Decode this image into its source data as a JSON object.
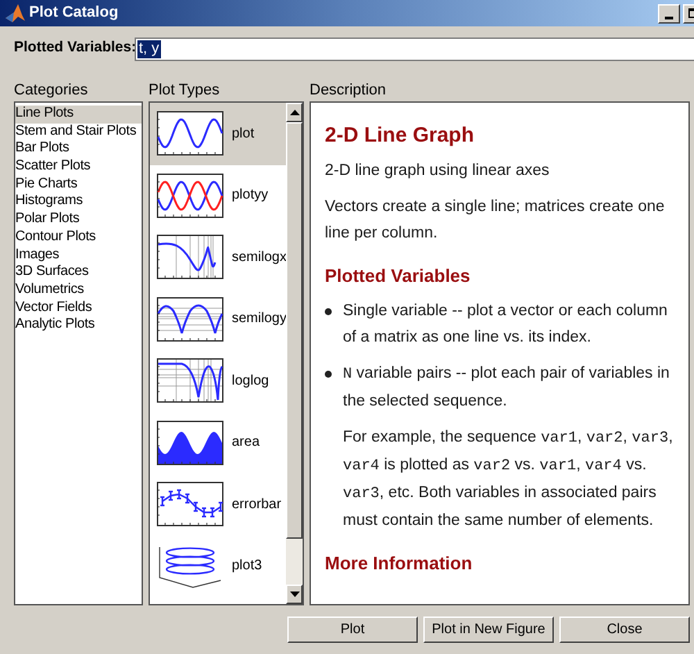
{
  "window": {
    "title": "Plot Catalog"
  },
  "plotted_variables": {
    "label": "Plotted Variables:",
    "value": "t, y"
  },
  "categories": {
    "heading": "Categories",
    "items": [
      {
        "label": "Line Plots",
        "selected": true
      },
      {
        "label": "Stem and Stair Plots",
        "selected": false
      },
      {
        "label": "Bar Plots",
        "selected": false
      },
      {
        "label": "Scatter Plots",
        "selected": false
      },
      {
        "label": "Pie Charts",
        "selected": false
      },
      {
        "label": "Histograms",
        "selected": false
      },
      {
        "label": "Polar Plots",
        "selected": false
      },
      {
        "label": "Contour Plots",
        "selected": false
      },
      {
        "label": "Images",
        "selected": false
      },
      {
        "label": "3D Surfaces",
        "selected": false
      },
      {
        "label": "Volumetrics",
        "selected": false
      },
      {
        "label": "Vector Fields",
        "selected": false
      },
      {
        "label": "Analytic Plots",
        "selected": false
      }
    ]
  },
  "plot_types": {
    "heading": "Plot Types",
    "items": [
      {
        "label": "plot",
        "selected": true
      },
      {
        "label": "plotyy",
        "selected": false
      },
      {
        "label": "semilogx",
        "selected": false
      },
      {
        "label": "semilogy",
        "selected": false
      },
      {
        "label": "loglog",
        "selected": false
      },
      {
        "label": "area",
        "selected": false
      },
      {
        "label": "errorbar",
        "selected": false
      },
      {
        "label": "plot3",
        "selected": false
      }
    ]
  },
  "description": {
    "heading": "Description",
    "blocks": [
      {
        "kind": "title",
        "parts": [
          {
            "kind": "text",
            "text": "2-D Line Graph"
          }
        ]
      },
      {
        "kind": "paragraph",
        "parts": [
          {
            "kind": "text",
            "text": "2-D line graph using linear axes"
          }
        ]
      },
      {
        "kind": "paragraph",
        "parts": [
          {
            "kind": "text",
            "text": "Vectors create a single line; matrices create one line per column."
          }
        ]
      },
      {
        "kind": "heading",
        "parts": [
          {
            "kind": "text",
            "text": "Plotted Variables"
          }
        ]
      },
      {
        "kind": "bullet",
        "parts": [
          {
            "kind": "text",
            "text": "Single variable -- plot a vector or each column of a matrix as one line vs. its index."
          }
        ]
      },
      {
        "kind": "bullet",
        "parts": [
          {
            "kind": "code",
            "text": "N"
          },
          {
            "kind": "text",
            "text": " variable pairs -- plot each pair of variables in the selected sequence."
          }
        ]
      },
      {
        "kind": "indented",
        "parts": [
          {
            "kind": "text",
            "text": "For example, the sequence "
          },
          {
            "kind": "code",
            "text": "var1"
          },
          {
            "kind": "text",
            "text": ", "
          },
          {
            "kind": "code",
            "text": "var2"
          },
          {
            "kind": "text",
            "text": ", "
          },
          {
            "kind": "code",
            "text": "var3"
          },
          {
            "kind": "text",
            "text": ", "
          },
          {
            "kind": "code",
            "text": "var4"
          },
          {
            "kind": "text",
            "text": " is plotted as "
          },
          {
            "kind": "code",
            "text": "var2"
          },
          {
            "kind": "text",
            "text": " vs. "
          },
          {
            "kind": "code",
            "text": "var1"
          },
          {
            "kind": "text",
            "text": ", "
          },
          {
            "kind": "code",
            "text": "var4"
          },
          {
            "kind": "text",
            "text": " vs. "
          },
          {
            "kind": "code",
            "text": "var3"
          },
          {
            "kind": "text",
            "text": ", etc. Both variables in associated pairs must contain the same number of elements."
          }
        ]
      },
      {
        "kind": "heading",
        "parts": [
          {
            "kind": "text",
            "text": "More Information"
          }
        ]
      }
    ]
  },
  "buttons": [
    {
      "label": "Plot"
    },
    {
      "label": "Plot in New Figure"
    },
    {
      "label": "Close"
    }
  ]
}
